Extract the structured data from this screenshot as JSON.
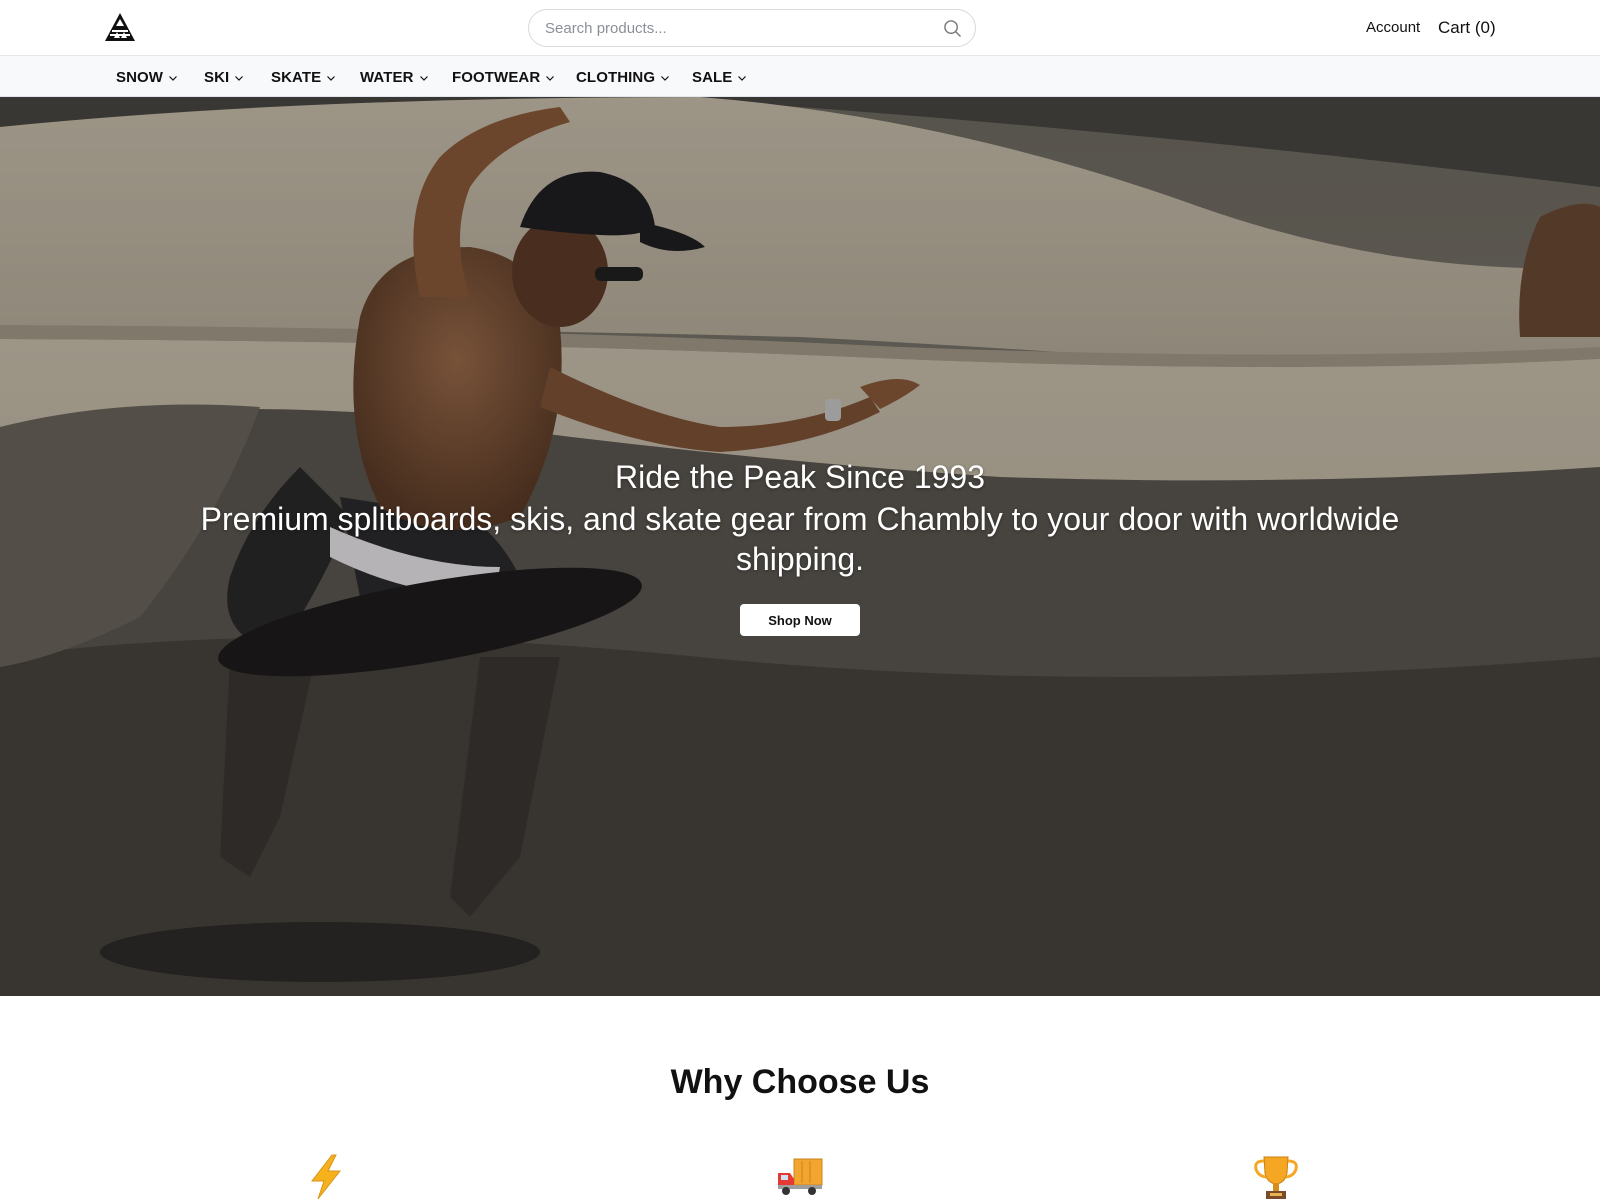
{
  "header": {
    "logo": "mountain-logo",
    "search_placeholder": "Search products...",
    "account_label": "Account",
    "cart_label": "Cart (0)"
  },
  "nav": {
    "items": [
      {
        "label": "SNOW"
      },
      {
        "label": "SKI"
      },
      {
        "label": "SKATE"
      },
      {
        "label": "WATER"
      },
      {
        "label": "FOOTWEAR"
      },
      {
        "label": "CLOTHING"
      },
      {
        "label": "SALE"
      }
    ]
  },
  "hero": {
    "title": "Ride the Peak Since 1993",
    "subtitle": "Premium splitboards, skis, and skate gear from Chambly to your door with worldwide shipping.",
    "cta_label": "Shop Now",
    "image": "skateboarder in concrete bowl"
  },
  "why": {
    "title": "Why Choose Us",
    "icons": [
      "lightning-icon",
      "delivery-truck-icon",
      "trophy-icon"
    ]
  },
  "colors": {
    "nav_bg": "#f8f9fb",
    "text": "#111111",
    "button_bg": "#ffffff"
  }
}
